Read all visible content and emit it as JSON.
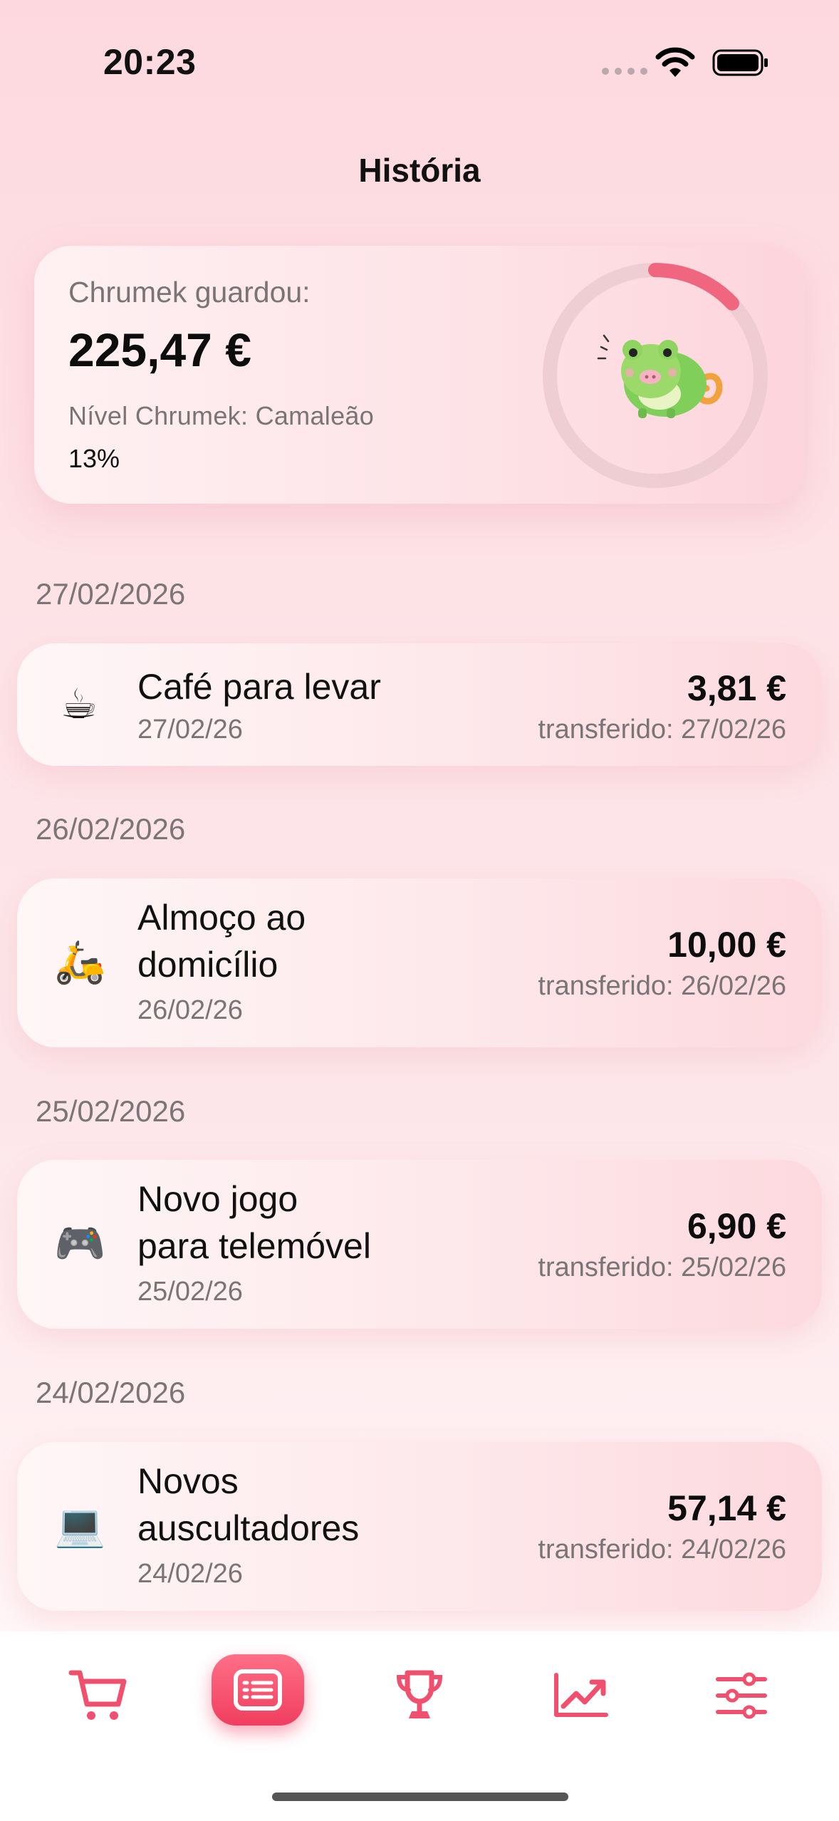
{
  "status_bar": {
    "time": "20:23"
  },
  "page": {
    "title": "História"
  },
  "summary": {
    "saved_label": "Chrumek guardou:",
    "saved_amount": "225,47 €",
    "level_label": "Nível Chrumek: Camaleão",
    "progress_text": "13%",
    "progress_value": 0.13,
    "accent_color": "#f0667f"
  },
  "history": [
    {
      "date_header": "27/02/2026",
      "icon": "coffee-icon",
      "emoji": "☕",
      "name_lines": [
        "Café para levar"
      ],
      "date": "27/02/26",
      "amount": "3,81 €",
      "transfer": "transferido: 27/02/26"
    },
    {
      "date_header": "26/02/2026",
      "icon": "scooter-icon",
      "emoji": "🛵",
      "name_lines": [
        "Almoço ao",
        "domicílio"
      ],
      "date": "26/02/26",
      "amount": "10,00 €",
      "transfer": "transferido: 26/02/26"
    },
    {
      "date_header": "25/02/2026",
      "icon": "gamepad-icon",
      "emoji": "🎮",
      "name_lines": [
        "Novo jogo",
        "para telemóvel"
      ],
      "date": "25/02/26",
      "amount": "6,90 €",
      "transfer": "transferido: 25/02/26"
    },
    {
      "date_header": "24/02/2026",
      "icon": "laptop-icon",
      "emoji": "💻",
      "name_lines": [
        "Novos",
        "auscultadores"
      ],
      "date": "24/02/26",
      "amount": "57,14 €",
      "transfer": "transferido: 24/02/26"
    }
  ],
  "tab_bar": {
    "tabs": [
      {
        "icon": "cart-icon",
        "active": false
      },
      {
        "icon": "history-list-icon",
        "active": true
      },
      {
        "icon": "trophy-icon",
        "active": false
      },
      {
        "icon": "chart-trend-icon",
        "active": false
      },
      {
        "icon": "sliders-icon",
        "active": false
      }
    ],
    "color": "#f0506e"
  }
}
